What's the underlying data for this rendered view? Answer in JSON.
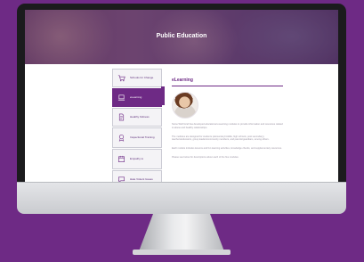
{
  "page": {
    "title": "Public Education"
  },
  "sidebar": {
    "items": [
      {
        "label": "Schools for Change",
        "icon": "cart-icon"
      },
      {
        "label": "eLearning",
        "icon": "laptop-icon",
        "active": true
      },
      {
        "label": "Healthy Kidness",
        "icon": "document-icon"
      },
      {
        "label": "Inspectional Training",
        "icon": "award-icon"
      },
      {
        "label": "Empathy to",
        "icon": "calendar-icon"
      },
      {
        "label": "Hate Violent Issues",
        "icon": "message-icon"
      }
    ]
  },
  "content": {
    "heading": "eLearning",
    "paragraphs": [
      "Stone Wolf Grief has developed educational eLearning modules to provide information and resources related to abuse and healthy relationships.",
      "The modules are designed for students (elementary/middle, high schools, post secondary), teachers/educators, group leaders/community members, and parents/guardians, among others.",
      "Each module includes lessons and fun learning activities, knowledge checks, and supplementary resources.",
      "Please see below for descriptions about each of the five modules."
    ]
  },
  "colors": {
    "accent": "#6e2a85",
    "background": "#6e2a85"
  }
}
